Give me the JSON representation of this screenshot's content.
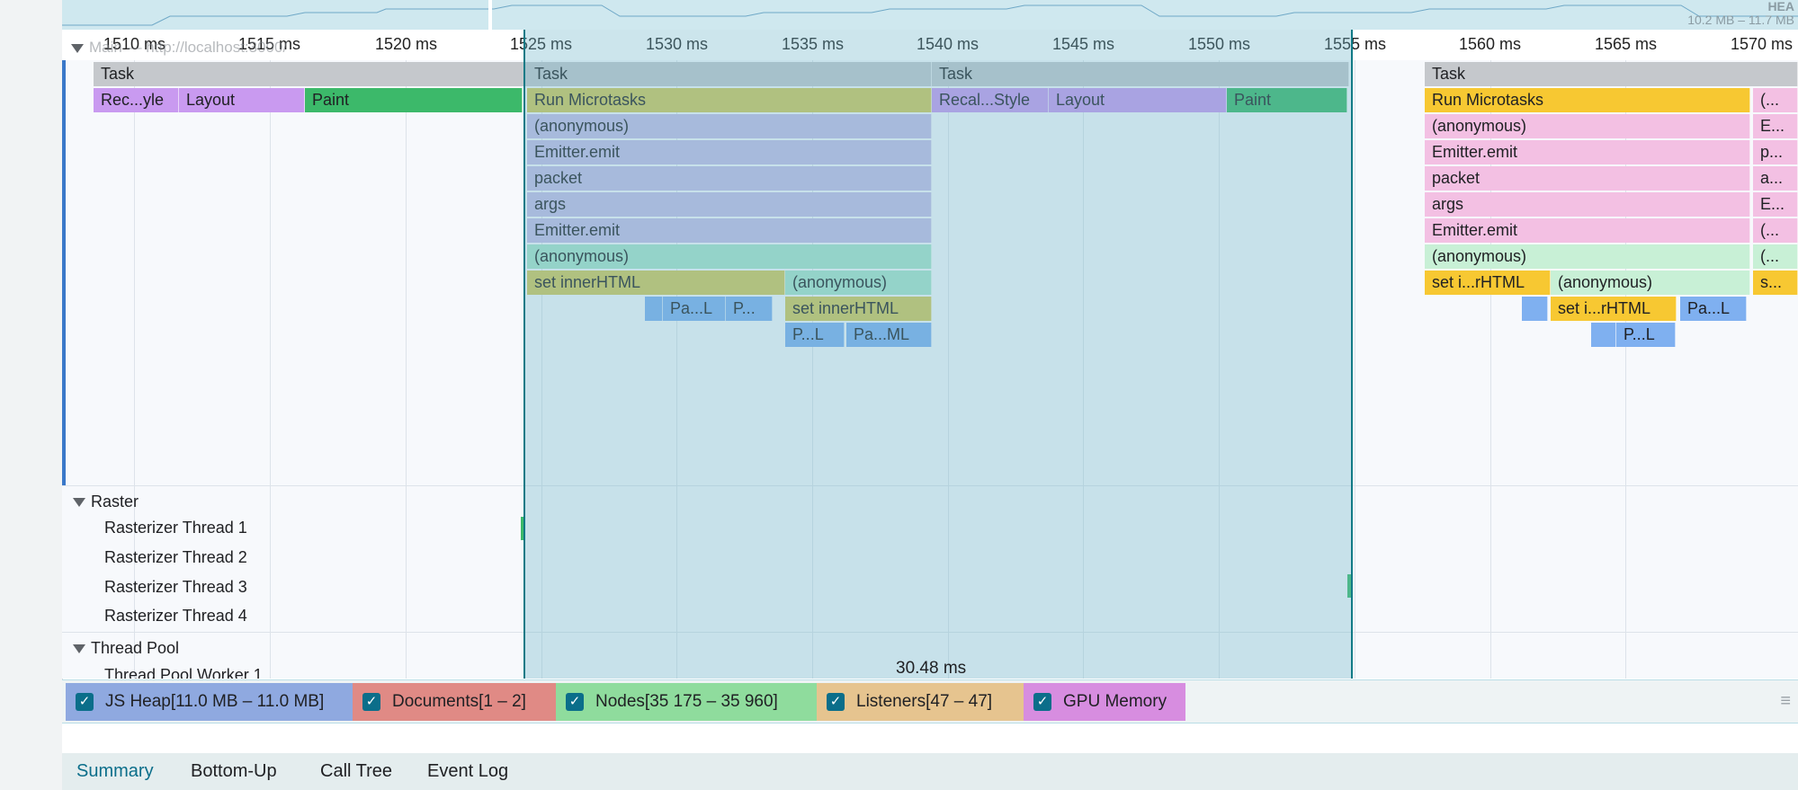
{
  "overview": {
    "heap_label_top": "HEA",
    "heap_range": "10.2 MB – 11.7 MB"
  },
  "ruler": {
    "ticks": [
      "1510 ms",
      "1515 ms",
      "1520 ms",
      "1525 ms",
      "1530 ms",
      "1535 ms",
      "1540 ms",
      "1545 ms",
      "1550 ms",
      "1555 ms",
      "1560 ms",
      "1565 ms",
      "1570 ms"
    ]
  },
  "main_track": {
    "label": "Main — http://localhost:3000/"
  },
  "flame": {
    "col1": {
      "task": "Task",
      "recalc": "Rec...yle",
      "layout": "Layout",
      "paint": "Paint"
    },
    "col2": {
      "task": "Task",
      "run_microtasks": "Run Microtasks",
      "anonymous1": "(anonymous)",
      "emitter1": "Emitter.emit",
      "packet": "packet",
      "args": "args",
      "emitter2": "Emitter.emit",
      "anonymous2": "(anonymous)",
      "set_innerhtml": "set innerHTML",
      "anonymous3": "(anonymous)",
      "pal": "Pa...L",
      "p_short": "P...",
      "set_innerhtml2": "set innerHTML",
      "pl": "P...L",
      "paml": "Pa...ML"
    },
    "col3": {
      "task": "Task",
      "recalc": "Recal...Style",
      "layout": "Layout",
      "paint": "Paint"
    },
    "col4": {
      "task": "Task",
      "run_microtasks": "Run Microtasks",
      "anonymous1": "(anonymous)",
      "emitter1": "Emitter.emit",
      "packet": "packet",
      "args": "args",
      "emitter2": "Emitter.emit",
      "anonymous2": "(anonymous)",
      "set_i_rhtml": "set i...rHTML",
      "anonymous3": "(anonymous)",
      "set_i_rhtml2": "set i...rHTML",
      "pal": "Pa...L",
      "pl": "P...L"
    },
    "col5": [
      "(...",
      "E...",
      "p...",
      "a...",
      "E...",
      "(...",
      "(...",
      "s..."
    ]
  },
  "raster": {
    "label": "Raster",
    "threads": [
      "Rasterizer Thread 1",
      "Rasterizer Thread 2",
      "Rasterizer Thread 3",
      "Rasterizer Thread 4"
    ]
  },
  "thread_pool": {
    "label": "Thread Pool",
    "worker": "Thread Pool Worker 1"
  },
  "selection": {
    "duration": "30.48 ms"
  },
  "counters": [
    {
      "label": "JS Heap[11.0 MB – 11.0 MB]",
      "color": "#8fa9e0",
      "checked": true
    },
    {
      "label": "Documents[1 – 2]",
      "color": "#e08a85",
      "checked": true
    },
    {
      "label": "Nodes[35 175 – 35 960]",
      "color": "#8fdc9d",
      "checked": true
    },
    {
      "label": "Listeners[47 – 47]",
      "color": "#e6c48f",
      "checked": true
    },
    {
      "label": "GPU Memory",
      "color": "#d78de0",
      "checked": true
    }
  ],
  "tabs": [
    "Summary",
    "Bottom-Up",
    "Call Tree",
    "Event Log"
  ],
  "colors": {
    "task": "#c5c8cc",
    "recalc": "#c99af0",
    "layout": "#c99af0",
    "paint": "#3cb96a",
    "microtasks": "#d4c85a",
    "js": "#c7bde6",
    "anonymous_green": "#a9e3c9",
    "script_pink": "#f3c0e3",
    "paint_small": "#7fb0f0",
    "yellow": "#f7c832",
    "selection": "#117a86"
  }
}
